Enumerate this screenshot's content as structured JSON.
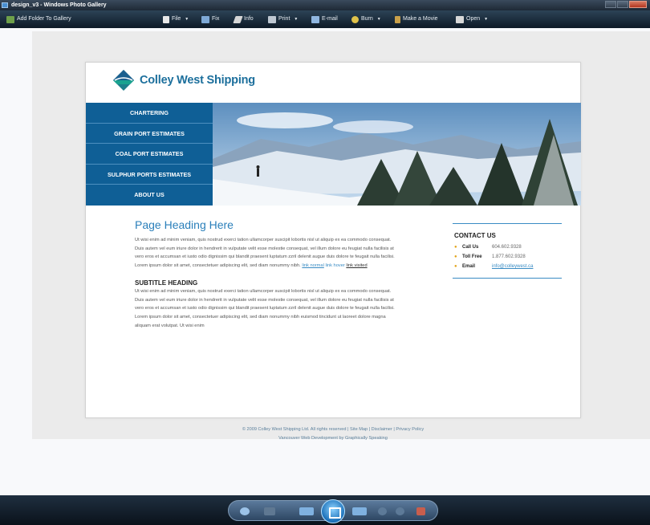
{
  "window": {
    "title": "design_v3 - Windows Photo Gallery"
  },
  "toolbar": {
    "add_folder": "Add Folder To Gallery",
    "file": "File",
    "fix": "Fix",
    "info": "Info",
    "print": "Print",
    "email": "E-mail",
    "burn": "Burn",
    "make_movie": "Make a Movie",
    "open": "Open"
  },
  "site": {
    "logo_text": "Colley West Shipping",
    "nav": [
      {
        "label": "CHARTERING"
      },
      {
        "label": "GRAIN PORT ESTIMATES"
      },
      {
        "label": "COAL PORT ESTIMATES"
      },
      {
        "label": "SULPHUR PORTS ESTIMATES"
      },
      {
        "label": "ABOUT US"
      }
    ],
    "heading": "Page Heading Here",
    "paragraph1": "Ut wisi enim ad minim veniam, quis nostrud exerci tation ullamcorper suscipit lobortis nisl ut aliquip ex ea commodo consequat.  Duis autem vel eum iriure dolor in hendrerit in vulputate velit esse molestie consequat, vel illum dolore eu feugiat nulla facilisis at vero eros et accumsan et iusto odio dignissim qui blandit praesent luptatum zzril delenit augue duis dolore te feugait nulla facilisi.  Lorem ipsum dolor sit amet, consectetuer adipiscing elit, sed diam nonummy nibh.",
    "link_normal": "link normal",
    "link_hover": "link hover",
    "link_visited": "link visited",
    "subtitle": "SUBTITLE HEADING",
    "paragraph2": "Ut wisi enim ad minim veniam, quis nostrud exerci tation ullamcorper suscipit lobortis nisl ut aliquip ex ea commodo consequat.  Duis autem vel eum iriure dolor in hendrerit in vulputate velit esse molestie consequat, vel illum dolore eu feugiat nulla facilisis at vero eros et accumsan et iusto odio dignissim qui blandit praesent luptatum zzril delenit augue duis dolore te feugait nulla facilisi.  Lorem ipsum dolor sit amet, consectetuer adipiscing elit, sed diam nonummy nibh euismod tincidunt ut laoreet dolore magna aliquam erat volutpat.  Ut wisi enim",
    "contact": {
      "heading": "CONTACT US",
      "call_label": "Call Us",
      "call_value": "604.602.9328",
      "tollfree_label": "Toll Free",
      "tollfree_value": "1.877.602.9328",
      "email_label": "Email",
      "email_value": "info@colleywest.ca"
    },
    "footer": {
      "line1": "© 2009 Colley West Shipping Ltd.  All rights reserved  |  Site Map  |  Disclaimer  |  Privacy Policy",
      "line2": "Vancouver Web Development by Graphically Speaking"
    }
  },
  "colors": {
    "nav_blue": "#0f5f96",
    "heading_blue": "#2a7fba",
    "accent_gold": "#e2a419"
  }
}
